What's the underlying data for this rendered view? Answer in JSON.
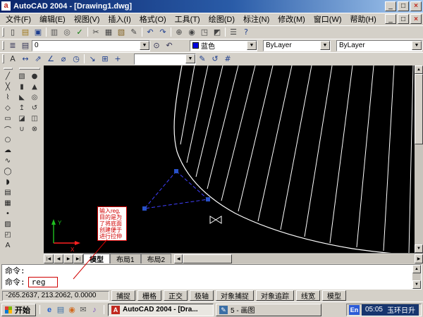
{
  "window": {
    "title": "AutoCAD 2004 - [Drawing1.dwg]",
    "app_icon_letter": "a",
    "controls": {
      "minimize": "_",
      "maximize": "□",
      "close": "×"
    }
  },
  "menu": {
    "items": [
      "文件(F)",
      "编辑(E)",
      "视图(V)",
      "插入(I)",
      "格式(O)",
      "工具(T)",
      "绘图(D)",
      "标注(N)",
      "修改(M)",
      "窗口(W)",
      "帮助(H)"
    ]
  },
  "toolbar1": {
    "icons": [
      {
        "name": "new-file-icon",
        "glyph": "▯",
        "color": "#333333"
      },
      {
        "name": "open-folder-icon",
        "glyph": "▤",
        "color": "#a07a1f"
      },
      {
        "name": "save-icon",
        "glyph": "▣",
        "color": "#1f3f8f"
      },
      {
        "sep": true
      },
      {
        "name": "print-icon",
        "glyph": "▥",
        "color": "#555555"
      },
      {
        "name": "print-preview-icon",
        "glyph": "◎",
        "color": "#555555"
      },
      {
        "name": "spell-check-icon",
        "glyph": "✓",
        "color": "#0a7a0a"
      },
      {
        "sep": true
      },
      {
        "name": "cut-icon",
        "glyph": "✂",
        "color": "#444444"
      },
      {
        "name": "copy-icon",
        "glyph": "▦",
        "color": "#444444"
      },
      {
        "name": "paste-icon",
        "glyph": "▧",
        "color": "#806020"
      },
      {
        "name": "match-properties-icon",
        "glyph": "✎",
        "color": "#444444"
      },
      {
        "sep": true
      },
      {
        "name": "undo-icon",
        "glyph": "↶",
        "color": "#1f3f8f"
      },
      {
        "name": "redo-icon",
        "glyph": "↷",
        "color": "#1f3f8f"
      },
      {
        "sep": true
      },
      {
        "name": "pan-icon",
        "glyph": "⊕",
        "color": "#444444"
      },
      {
        "name": "zoom-realtime-icon",
        "glyph": "◉",
        "color": "#444444"
      },
      {
        "name": "zoom-window-icon",
        "glyph": "◳",
        "color": "#444444"
      },
      {
        "name": "zoom-previous-icon",
        "glyph": "◩",
        "color": "#444444"
      },
      {
        "sep": true
      },
      {
        "name": "properties-icon",
        "glyph": "☰",
        "color": "#444444"
      },
      {
        "name": "help-icon",
        "glyph": "?",
        "color": "#1f3f8f"
      }
    ]
  },
  "toolbar2": {
    "icons_left": [
      {
        "name": "layer-properties-manager-icon",
        "glyph": "≣",
        "color": "#333355"
      },
      {
        "name": "layer-states-icon",
        "glyph": "▤",
        "color": "#333355"
      }
    ],
    "layer_combo": {
      "value": "0"
    },
    "icons_mid": [
      {
        "name": "make-object-layer-current-icon",
        "glyph": "⊙",
        "color": "#333355"
      },
      {
        "name": "layer-previous-icon",
        "glyph": "↶",
        "color": "#333355"
      }
    ],
    "color_combo": {
      "value": "蓝色",
      "swatch_hex": "#0000e0"
    },
    "linetype_combo": {
      "value": "ByLayer"
    },
    "lineweight_combo": {
      "value": "ByLayer"
    }
  },
  "toolbar3": {
    "icons_left": [
      {
        "name": "text-style-icon",
        "glyph": "A",
        "color": "#333333"
      },
      {
        "name": "dim-linear-icon",
        "glyph": "↔",
        "color": "#1f3f8f"
      },
      {
        "name": "dim-aligned-icon",
        "glyph": "⇗",
        "color": "#1f3f8f"
      },
      {
        "name": "dim-angular-icon",
        "glyph": "∠",
        "color": "#1f3f8f"
      },
      {
        "name": "dim-diameter-icon",
        "glyph": "⌀",
        "color": "#1f3f8f"
      },
      {
        "name": "dim-radius-icon",
        "glyph": "◷",
        "color": "#1f3f8f"
      },
      {
        "sep": true
      },
      {
        "name": "quick-leader-icon",
        "glyph": "↘",
        "color": "#1f3f8f"
      },
      {
        "name": "tolerance-icon",
        "glyph": "⊞",
        "color": "#1f3f8f"
      },
      {
        "name": "center-mark-icon",
        "glyph": "+",
        "color": "#1f3f8f"
      }
    ],
    "style_combo": {
      "value": ""
    },
    "icons_right": [
      {
        "name": "dim-edit-icon",
        "glyph": "✎",
        "color": "#1f3f8f"
      },
      {
        "name": "dim-update-icon",
        "glyph": "↺",
        "color": "#1f3f8f"
      },
      {
        "name": "dim-style-icon",
        "glyph": "#",
        "color": "#1f3f8f"
      }
    ]
  },
  "draw_toolbar": {
    "icons": [
      {
        "name": "line-icon",
        "glyph": "╱",
        "color": "#222222"
      },
      {
        "name": "construction-line-icon",
        "glyph": "╳",
        "color": "#222222"
      },
      {
        "name": "polyline-icon",
        "glyph": "⌇",
        "color": "#222222"
      },
      {
        "name": "polygon-icon",
        "glyph": "◇",
        "color": "#222222"
      },
      {
        "name": "rectangle-icon",
        "glyph": "▭",
        "color": "#222222"
      },
      {
        "name": "arc-icon",
        "glyph": "⌒",
        "color": "#222222"
      },
      {
        "name": "circle-icon",
        "glyph": "○",
        "color": "#222222"
      },
      {
        "name": "revcloud-icon",
        "glyph": "☁",
        "color": "#222222"
      },
      {
        "name": "spline-icon",
        "glyph": "∿",
        "color": "#222222"
      },
      {
        "name": "ellipse-icon",
        "glyph": "◯",
        "color": "#222222"
      },
      {
        "name": "ellipse-arc-icon",
        "glyph": "◗",
        "color": "#222222"
      },
      {
        "name": "insert-block-icon",
        "glyph": "▤",
        "color": "#222222"
      },
      {
        "name": "make-block-icon",
        "glyph": "▦",
        "color": "#222222"
      },
      {
        "name": "point-icon",
        "glyph": "•",
        "color": "#222222"
      },
      {
        "name": "hatch-icon",
        "glyph": "▨",
        "color": "#222222"
      },
      {
        "name": "region-icon",
        "glyph": "◰",
        "color": "#222222"
      },
      {
        "name": "mtext-icon",
        "glyph": "A",
        "color": "#222222"
      }
    ]
  },
  "model_toolbar": {
    "icons": [
      {
        "name": "box-icon",
        "glyph": "▧",
        "color": "#333333"
      },
      {
        "name": "sphere-icon",
        "glyph": "●",
        "color": "#333333"
      },
      {
        "name": "cylinder-icon",
        "glyph": "▮",
        "color": "#333333"
      },
      {
        "name": "cone-icon",
        "glyph": "▲",
        "color": "#333333"
      },
      {
        "name": "wedge-icon",
        "glyph": "◣",
        "color": "#333333"
      },
      {
        "name": "torus-icon",
        "glyph": "◎",
        "color": "#333333"
      },
      {
        "name": "extrude-icon",
        "glyph": "↥",
        "color": "#333333"
      },
      {
        "name": "revolve-icon",
        "glyph": "↺",
        "color": "#333333"
      },
      {
        "name": "slice-icon",
        "glyph": "◪",
        "color": "#333333"
      },
      {
        "name": "section-icon",
        "glyph": "◫",
        "color": "#333333"
      },
      {
        "name": "union-icon",
        "glyph": "∪",
        "color": "#333333"
      },
      {
        "name": "subtract-icon",
        "glyph": "⊗",
        "color": "#333333"
      }
    ]
  },
  "drawing": {
    "annotation": {
      "lines": [
        "输入reg,",
        "目的是为",
        "了将底面",
        "创建便于",
        "进行拉伸"
      ]
    },
    "ucs": {
      "x_label": "X",
      "y_label": "Y"
    },
    "selected_color_hex": "#4040ff",
    "grip_color_hex": "#2851c8",
    "wireframe_color_hex": "#ffffff"
  },
  "tabs": {
    "nav": [
      "|◀",
      "◀",
      "▶",
      "▶|"
    ],
    "items": [
      "模型",
      "布局1",
      "布局2"
    ],
    "active": "模型"
  },
  "command": {
    "history_line": "命令:",
    "prompt": "命令:",
    "input": "reg"
  },
  "status": {
    "coordinates": "-265.2637, 213.2062, 0.0000",
    "buttons": [
      "捕捉",
      "栅格",
      "正交",
      "极轴",
      "对象捕捉",
      "对象追踪",
      "线宽",
      "模型"
    ]
  },
  "taskbar": {
    "start_label": "开始",
    "quick_launch": [
      {
        "name": "ie-icon",
        "glyph": "e",
        "color": "#1f5fcf"
      },
      {
        "name": "show-desktop-icon",
        "glyph": "▤",
        "color": "#3a6ea5"
      },
      {
        "name": "media-player-icon",
        "glyph": "◉",
        "color": "#d06a1f"
      },
      {
        "name": "mail-icon",
        "glyph": "✉",
        "color": "#555555"
      },
      {
        "name": "messenger-icon",
        "glyph": "♪",
        "color": "#7a4fbf"
      }
    ],
    "tasks": [
      {
        "label": "AutoCAD 2004 - [Dra...",
        "icon_glyph": "A",
        "icon_color": "#c0281e"
      },
      {
        "label": "5 - 画图",
        "icon_glyph": "✎",
        "icon_color": "#3a6ea5"
      }
    ],
    "tray": {
      "ime": "En",
      "time": "05:05",
      "watermark": "玉环日升"
    }
  }
}
